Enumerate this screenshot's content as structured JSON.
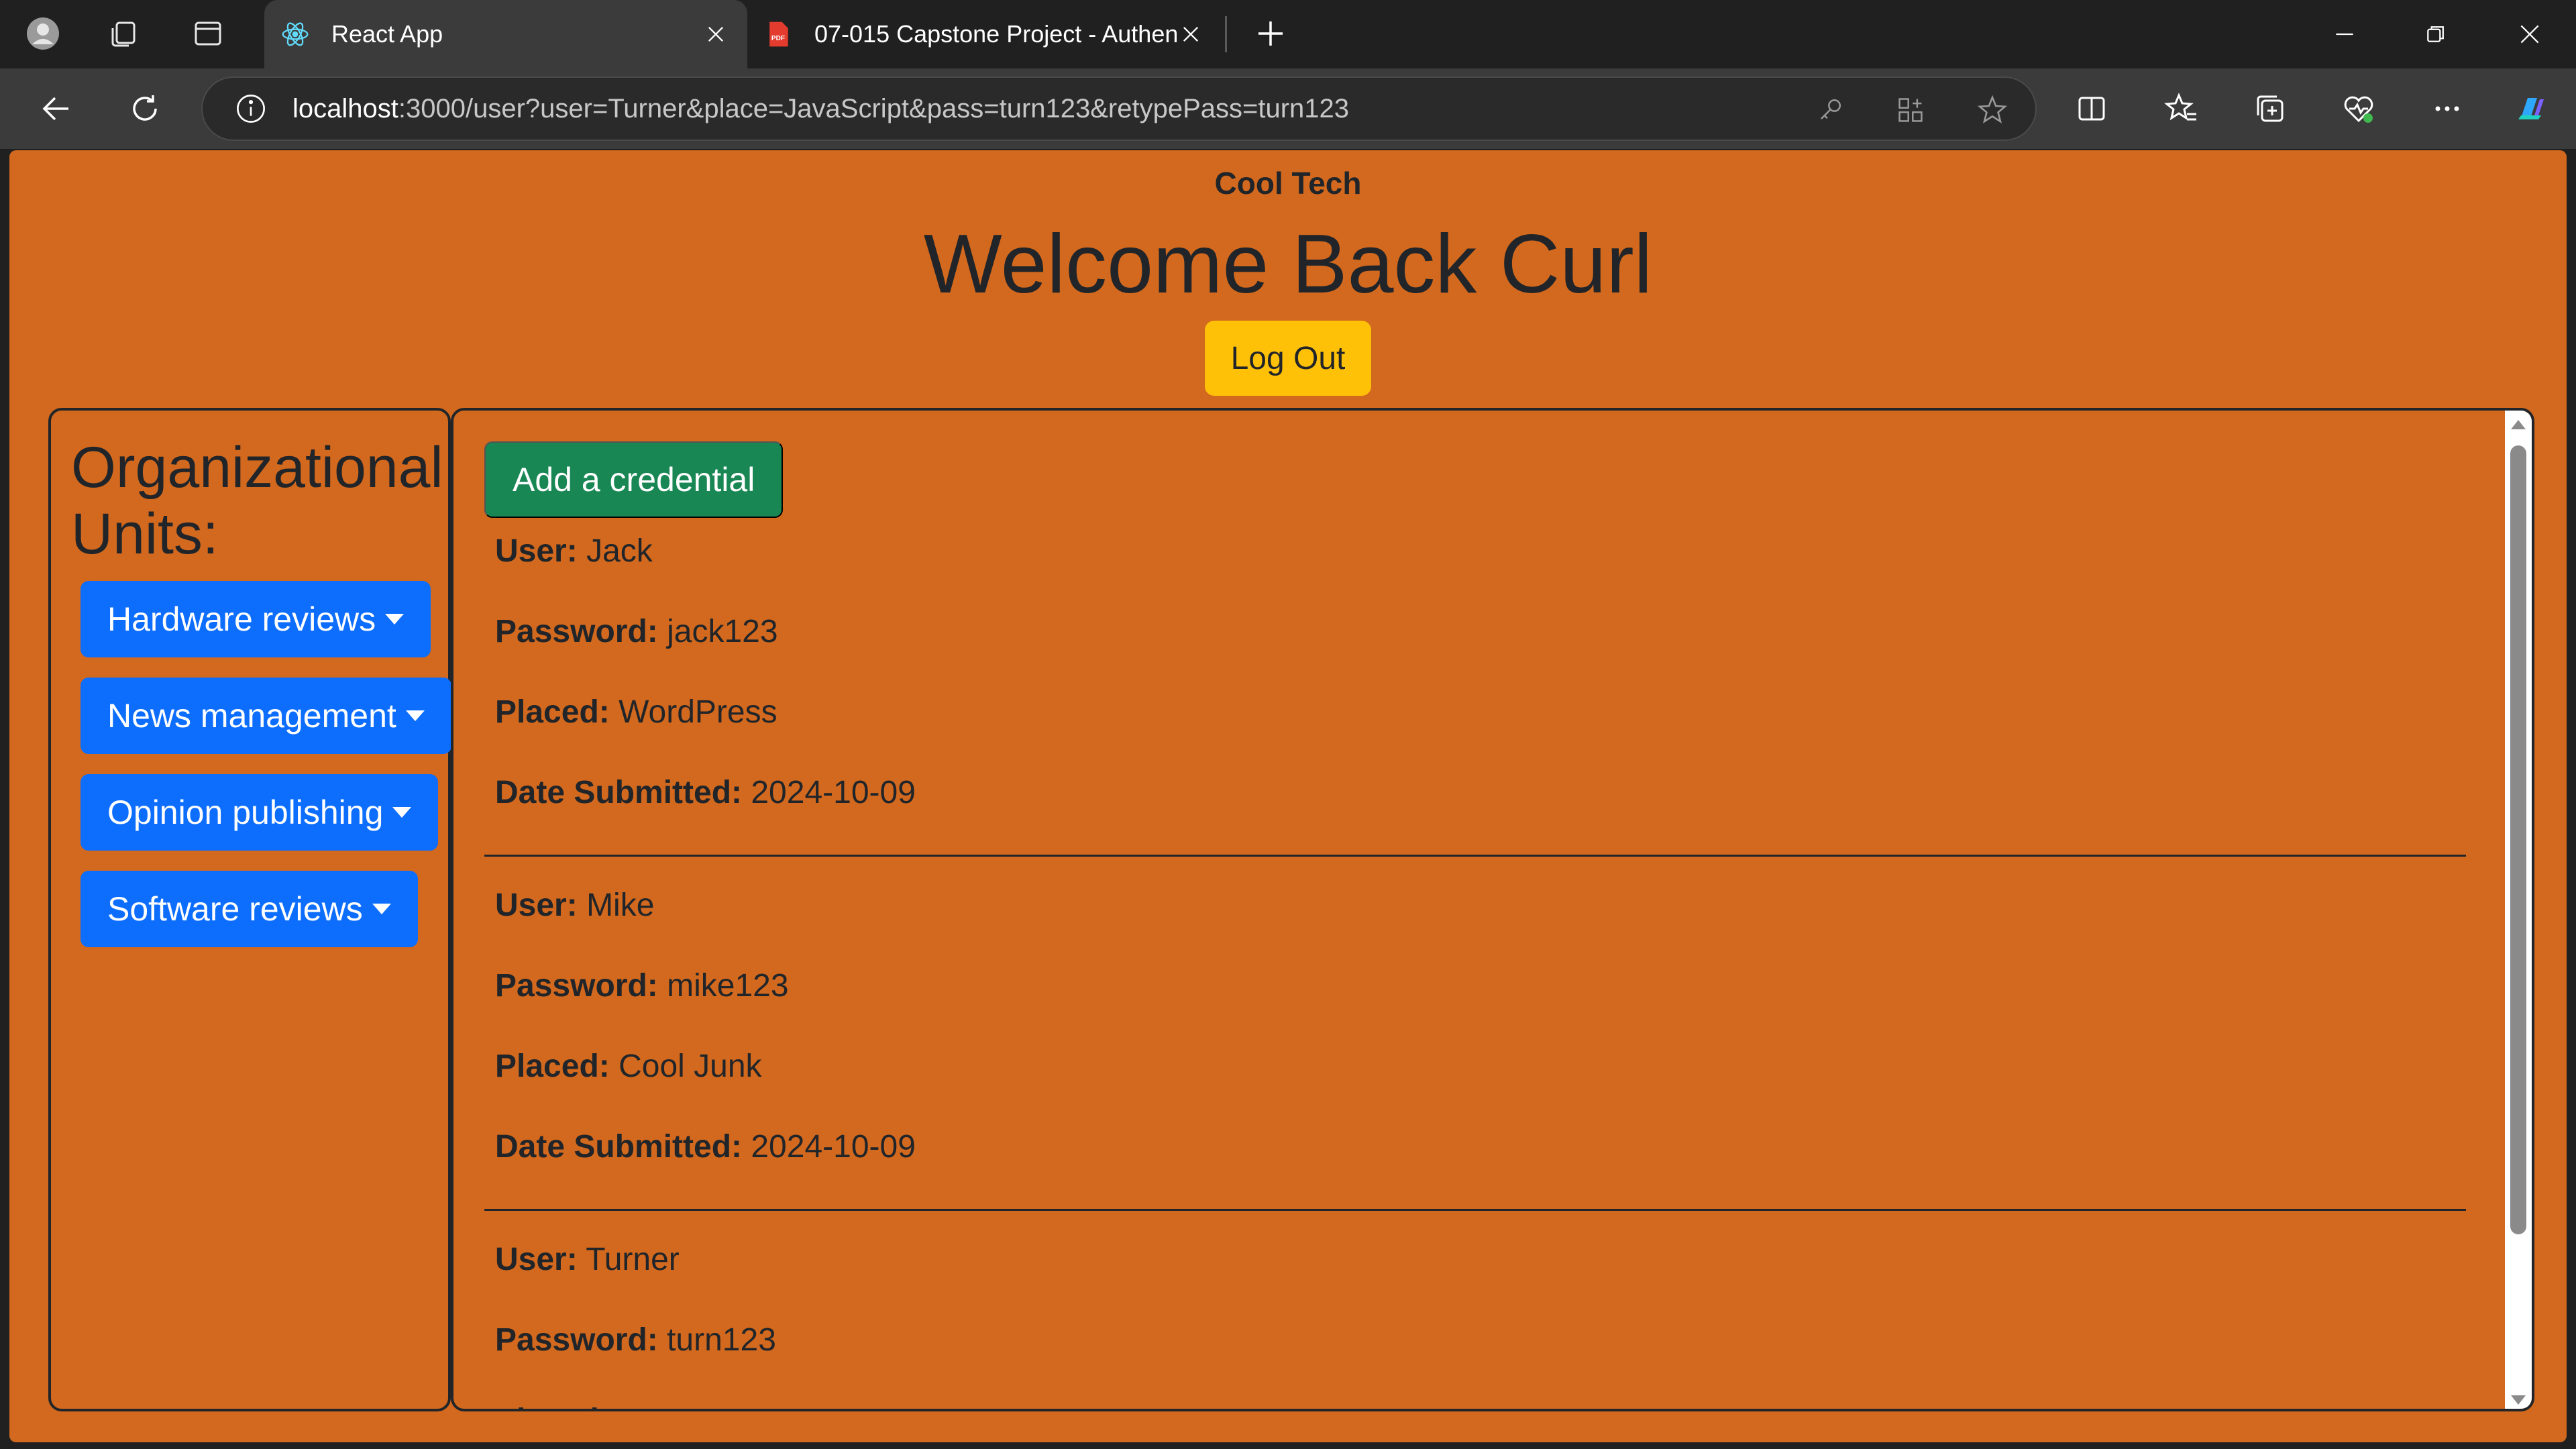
{
  "browser": {
    "tabs": [
      {
        "title": "React App",
        "active": true,
        "favicon": "react-icon"
      },
      {
        "title": "07-015 Capstone Project - Authen",
        "active": false,
        "favicon": "pdf-icon"
      }
    ],
    "address": {
      "host": "localhost",
      "rest": ":3000/user?user=Turner&place=JavaScript&pass=turn123&retypePass=turn123"
    }
  },
  "page": {
    "brand": "Cool Tech",
    "welcome": "Welcome Back Curl",
    "logout_label": "Log Out",
    "colors": {
      "background": "#d2691e",
      "primary": "#0d6efd",
      "success": "#198754",
      "warning": "#ffc107"
    }
  },
  "sidebar": {
    "heading": "Organizational Units:",
    "units": [
      {
        "label": "Hardware reviews"
      },
      {
        "label": "News management"
      },
      {
        "label": "Opinion publishing"
      },
      {
        "label": "Software reviews"
      }
    ]
  },
  "credentials": {
    "add_label": "Add a credential",
    "field_labels": {
      "user": "User:",
      "password": "Password:",
      "placed": "Placed:",
      "date": "Date Submitted:"
    },
    "items": [
      {
        "user": "Jack",
        "password": "jack123",
        "placed": "WordPress",
        "date": "2024-10-09"
      },
      {
        "user": "Mike",
        "password": "mike123",
        "placed": "Cool Junk",
        "date": "2024-10-09"
      },
      {
        "user": "Turner",
        "password": "turn123"
      }
    ]
  }
}
